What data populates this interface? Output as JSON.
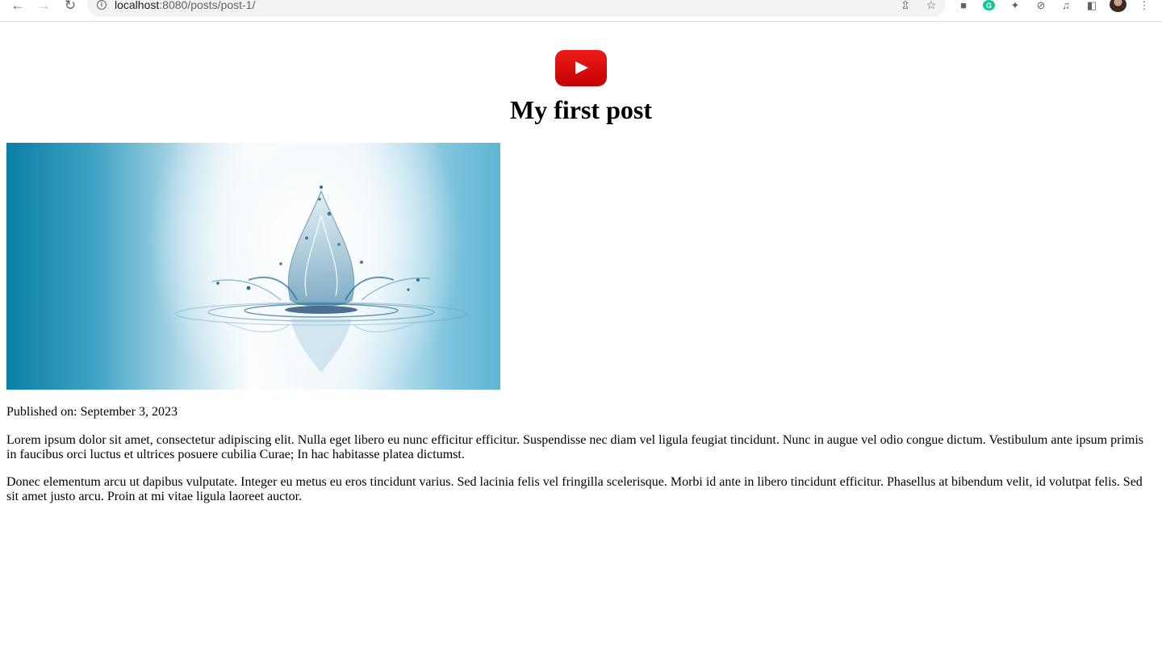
{
  "browser": {
    "url_host": "localhost",
    "url_path": ":8080/posts/post-1/",
    "icons": {
      "back": "arrow-left-icon",
      "forward": "arrow-right-icon",
      "reload": "reload-icon",
      "site_info": "info-icon",
      "share": "share-icon",
      "bookmark": "star-icon",
      "extensions": [
        "extension-a-icon",
        "grammarly-icon",
        "puzzle-icon",
        "sync-icon",
        "media-icon",
        "side-panel-icon"
      ],
      "menu": "kebab-menu-icon"
    }
  },
  "post": {
    "logo": "youtube-logo",
    "title": "My first post",
    "image": "water-splash-image",
    "published": "Published on: September 3, 2023",
    "paragraphs": [
      "Lorem ipsum dolor sit amet, consectetur adipiscing elit. Nulla eget libero eu nunc efficitur efficitur. Suspendisse nec diam vel ligula feugiat tincidunt. Nunc in augue vel odio congue dictum. Vestibulum ante ipsum primis in faucibus orci luctus et ultrices posuere cubilia Curae; In hac habitasse platea dictumst.",
      "Donec elementum arcu ut dapibus vulputate. Integer eu metus eu eros tincidunt varius. Sed lacinia felis vel fringilla scelerisque. Morbi id ante in libero tincidunt efficitur. Phasellus at bibendum velit, id volutpat felis. Sed sit amet justo arcu. Proin at mi vitae ligula laoreet auctor."
    ]
  },
  "colors": {
    "logo_red": "#e01010",
    "accent_blue": "#0a7fa5"
  }
}
